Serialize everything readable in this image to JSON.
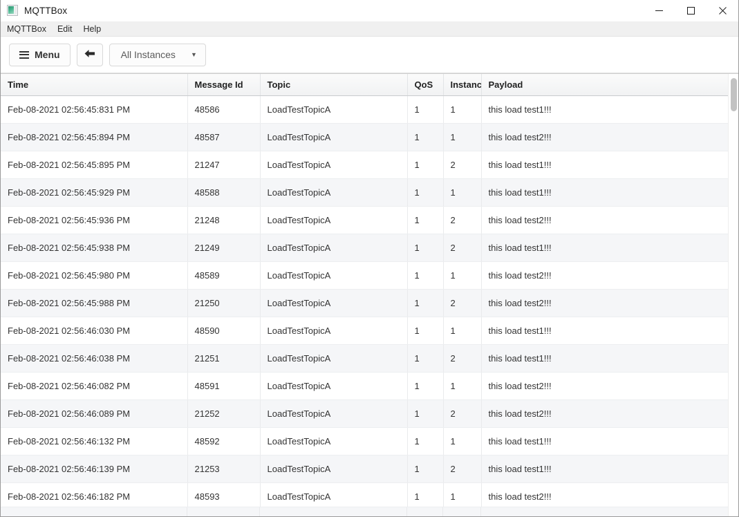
{
  "window": {
    "title": "MQTTBox",
    "icon": "app-window-icon",
    "controls": {
      "minimize": "minimize-icon",
      "maximize": "maximize-icon",
      "close": "close-icon"
    }
  },
  "menubar": {
    "items": [
      {
        "label": "MQTTBox"
      },
      {
        "label": "Edit"
      },
      {
        "label": "Help"
      }
    ]
  },
  "toolbar": {
    "menu_label": "Menu",
    "menu_icon": "hamburger-icon",
    "back_icon": "arrow-left-icon",
    "instances_selected": "All Instances",
    "instances_caret": "▼"
  },
  "table": {
    "columns": [
      {
        "key": "time",
        "label": "Time"
      },
      {
        "key": "msgid",
        "label": "Message Id"
      },
      {
        "key": "topic",
        "label": "Topic"
      },
      {
        "key": "qos",
        "label": "QoS"
      },
      {
        "key": "instance",
        "label": "Instance"
      },
      {
        "key": "payload",
        "label": "Payload"
      }
    ],
    "rows": [
      {
        "time": "Feb-08-2021 02:56:45:831 PM",
        "msgid": "48586",
        "topic": "LoadTestTopicA",
        "qos": "1",
        "instance": "1",
        "payload": "this load test1!!!"
      },
      {
        "time": "Feb-08-2021 02:56:45:894 PM",
        "msgid": "48587",
        "topic": "LoadTestTopicA",
        "qos": "1",
        "instance": "1",
        "payload": "this load test2!!!"
      },
      {
        "time": "Feb-08-2021 02:56:45:895 PM",
        "msgid": "21247",
        "topic": "LoadTestTopicA",
        "qos": "1",
        "instance": "2",
        "payload": "this load test1!!!"
      },
      {
        "time": "Feb-08-2021 02:56:45:929 PM",
        "msgid": "48588",
        "topic": "LoadTestTopicA",
        "qos": "1",
        "instance": "1",
        "payload": "this load test1!!!"
      },
      {
        "time": "Feb-08-2021 02:56:45:936 PM",
        "msgid": "21248",
        "topic": "LoadTestTopicA",
        "qos": "1",
        "instance": "2",
        "payload": "this load test2!!!"
      },
      {
        "time": "Feb-08-2021 02:56:45:938 PM",
        "msgid": "21249",
        "topic": "LoadTestTopicA",
        "qos": "1",
        "instance": "2",
        "payload": "this load test1!!!"
      },
      {
        "time": "Feb-08-2021 02:56:45:980 PM",
        "msgid": "48589",
        "topic": "LoadTestTopicA",
        "qos": "1",
        "instance": "1",
        "payload": "this load test2!!!"
      },
      {
        "time": "Feb-08-2021 02:56:45:988 PM",
        "msgid": "21250",
        "topic": "LoadTestTopicA",
        "qos": "1",
        "instance": "2",
        "payload": "this load test2!!!"
      },
      {
        "time": "Feb-08-2021 02:56:46:030 PM",
        "msgid": "48590",
        "topic": "LoadTestTopicA",
        "qos": "1",
        "instance": "1",
        "payload": "this load test1!!!"
      },
      {
        "time": "Feb-08-2021 02:56:46:038 PM",
        "msgid": "21251",
        "topic": "LoadTestTopicA",
        "qos": "1",
        "instance": "2",
        "payload": "this load test1!!!"
      },
      {
        "time": "Feb-08-2021 02:56:46:082 PM",
        "msgid": "48591",
        "topic": "LoadTestTopicA",
        "qos": "1",
        "instance": "1",
        "payload": "this load test2!!!"
      },
      {
        "time": "Feb-08-2021 02:56:46:089 PM",
        "msgid": "21252",
        "topic": "LoadTestTopicA",
        "qos": "1",
        "instance": "2",
        "payload": "this load test2!!!"
      },
      {
        "time": "Feb-08-2021 02:56:46:132 PM",
        "msgid": "48592",
        "topic": "LoadTestTopicA",
        "qos": "1",
        "instance": "1",
        "payload": "this load test1!!!"
      },
      {
        "time": "Feb-08-2021 02:56:46:139 PM",
        "msgid": "21253",
        "topic": "LoadTestTopicA",
        "qos": "1",
        "instance": "2",
        "payload": "this load test1!!!"
      },
      {
        "time": "Feb-08-2021 02:56:46:182 PM",
        "msgid": "48593",
        "topic": "LoadTestTopicA",
        "qos": "1",
        "instance": "1",
        "payload": "this load test2!!!"
      }
    ]
  },
  "colors": {
    "row_alt": "#f5f6f8",
    "header_bg": "#f1f2f3",
    "border": "#e9eaec",
    "text": "#333333",
    "accent": "#2f8f6f"
  }
}
